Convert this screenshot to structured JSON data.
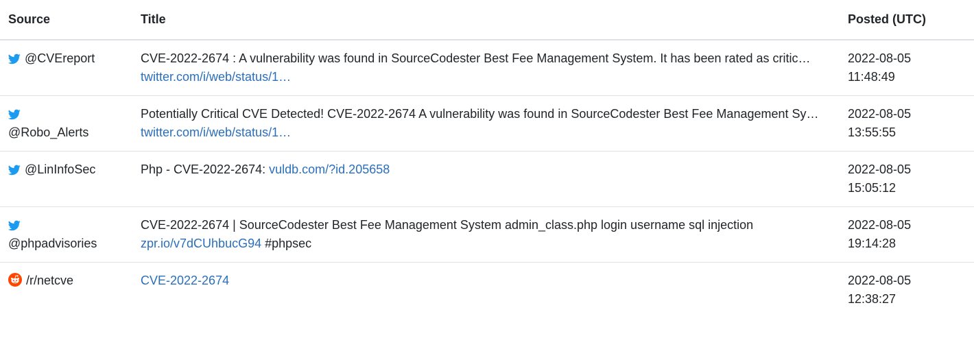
{
  "header": {
    "source": "Source",
    "title": "Title",
    "posted": "Posted (UTC)"
  },
  "colors": {
    "twitter_blue": "#1d9bf0",
    "reddit_orange": "#ff4500",
    "link": "#2a6fbd",
    "border": "#dee2e6"
  },
  "rows": [
    {
      "icon": "twitter-bird-icon",
      "source": "@CVEreport",
      "text": "CVE-2022-2674 : A vulnerability was found in SourceCodester Best Fee Management System. It has been rated as critic… ",
      "link": "twitter.com/i/web/status/1…",
      "tail": "",
      "date": "2022-08-05",
      "time": "11:48:49"
    },
    {
      "icon": "twitter-bird-icon",
      "source": "@Robo_Alerts",
      "text": "Potentially Critical CVE Detected! CVE-2022-2674 A vulnerability was found in SourceCodester Best Fee Management Sy… ",
      "link": "twitter.com/i/web/status/1…",
      "tail": "",
      "date": "2022-08-05",
      "time": "13:55:55"
    },
    {
      "icon": "twitter-bird-icon",
      "source": "@LinInfoSec",
      "text": "Php - CVE-2022-2674: ",
      "link": "vuldb.com/?id.205658",
      "tail": "",
      "date": "2022-08-05",
      "time": "15:05:12"
    },
    {
      "icon": "twitter-bird-icon",
      "source": "@phpadvisories",
      "text": "CVE-2022-2674 | SourceCodester Best Fee Management System admin_class.php login username sql injection ",
      "link": "zpr.io/v7dCUhbucG94",
      "tail": " #phpsec",
      "date": "2022-08-05",
      "time": "19:14:28"
    },
    {
      "icon": "reddit-alien-icon",
      "source": "/r/netcve",
      "text": "",
      "link": "CVE-2022-2674",
      "tail": "",
      "date": "2022-08-05",
      "time": "12:38:27"
    }
  ]
}
